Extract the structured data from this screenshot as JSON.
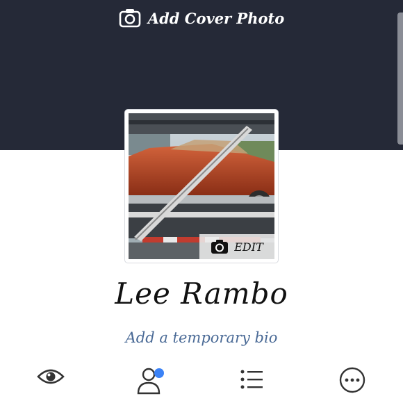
{
  "cover": {
    "add_cover_label": "Add Cover Photo",
    "background_color": "#252937"
  },
  "profile": {
    "name": "Lee Rambo",
    "edit_label": "EDIT",
    "bio_placeholder": "Add a temporary bio",
    "photo_icon": "orange-car-on-car-carrier-photo"
  },
  "actions": [
    {
      "icon": "eye-icon",
      "label": "",
      "badge": false
    },
    {
      "icon": "person-icon",
      "label": "",
      "badge": true,
      "badge_color": "#3b82f6"
    },
    {
      "icon": "list-icon",
      "label": "",
      "badge": false
    },
    {
      "icon": "more-icon",
      "label": "",
      "badge": false
    }
  ]
}
